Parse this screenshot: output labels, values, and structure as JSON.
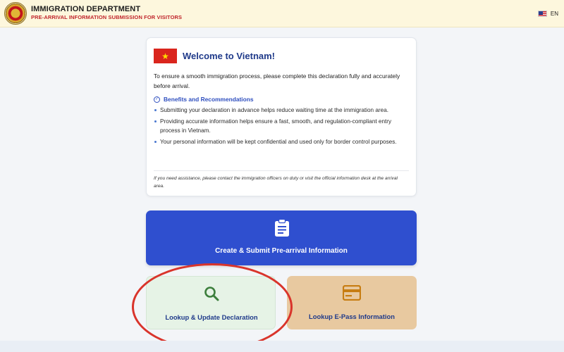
{
  "header": {
    "title": "IMMIGRATION DEPARTMENT",
    "subtitle": "PRE-ARRIVAL INFORMATION SUBMISSION FOR VISITORS",
    "language": "EN"
  },
  "welcome_card": {
    "flag_icon": "vietnam-flag-icon",
    "title": "Welcome to Vietnam!",
    "intro": "To ensure a smooth immigration process, please complete this declaration fully and accurately before arrival.",
    "benefits_title": "Benefits and Recommendations",
    "benefits": [
      "Submitting your declaration in advance helps reduce waiting time at the immigration area.",
      "Providing accurate information helps ensure a fast, smooth, and regulation-compliant entry process in Vietnam.",
      "Your personal information will be kept confidential and used only for border control purposes."
    ],
    "note": "If you need assistance, please contact the immigration officers on duty or visit the official information desk at the arrival area."
  },
  "actions": {
    "create_label": "Create & Submit Pre-arrival Information",
    "lookup_label": "Lookup & Update Declaration",
    "epass_label": "Lookup E-Pass Information"
  },
  "colors": {
    "header_bg": "#fdf7dd",
    "primary": "#2f4fcf",
    "title_blue": "#1f3a8a",
    "lookup_bg": "#e6f3e6",
    "epass_bg": "#e8c9a0",
    "annotation_red": "#d9342b"
  }
}
